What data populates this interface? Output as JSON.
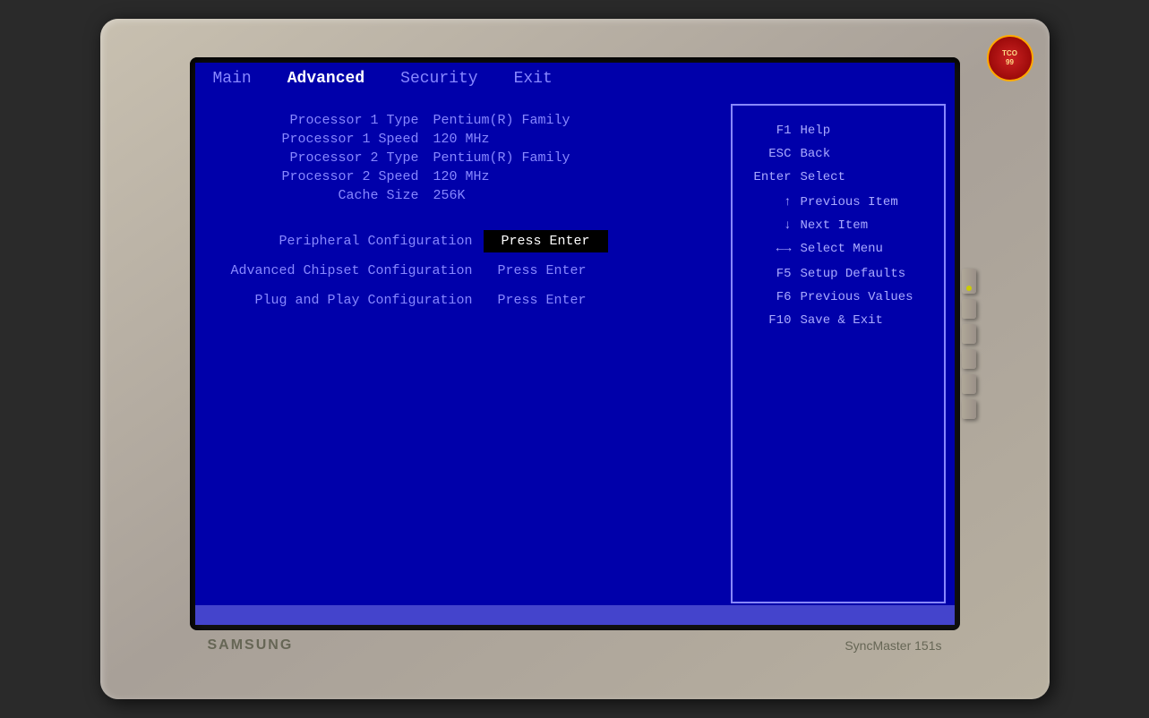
{
  "monitor": {
    "brand": "SAMSUNG",
    "model": "SyncMaster 151s",
    "tco_badge": "TCO\n99"
  },
  "bios": {
    "menu_items": [
      {
        "label": "Main",
        "active": false
      },
      {
        "label": "Advanced",
        "active": true
      },
      {
        "label": "Security",
        "active": false
      },
      {
        "label": "Exit",
        "active": false
      }
    ],
    "processor_info": [
      {
        "label": "Processor 1  Type",
        "value": "Pentium(R) Family"
      },
      {
        "label": "Processor 1 Speed",
        "value": "120 MHz"
      },
      {
        "label": "Processor 2  Type",
        "value": "Pentium(R) Family"
      },
      {
        "label": "Processor 2 Speed",
        "value": "120 MHz"
      },
      {
        "label": "Cache Size",
        "value": "256K"
      }
    ],
    "config_items": [
      {
        "label": "Peripheral Configuration",
        "value": "Press Enter",
        "highlighted": true
      },
      {
        "label": "Advanced Chipset Configuration",
        "value": "Press Enter",
        "highlighted": false
      },
      {
        "label": "Plug and Play Configuration",
        "value": "Press Enter",
        "highlighted": false
      }
    ],
    "help_items": [
      {
        "key": "F1",
        "desc": "Help"
      },
      {
        "key": "ESC",
        "desc": "Back"
      },
      {
        "key": "Enter",
        "desc": "Select"
      },
      {
        "key": "↑",
        "desc": "Previous Item"
      },
      {
        "key": "↓",
        "desc": "Next Item"
      },
      {
        "key": "←→",
        "desc": "Select Menu"
      },
      {
        "key": "F5",
        "desc": "Setup Defaults"
      },
      {
        "key": "F6",
        "desc": "Previous Values"
      },
      {
        "key": "F10",
        "desc": "Save & Exit"
      }
    ]
  }
}
